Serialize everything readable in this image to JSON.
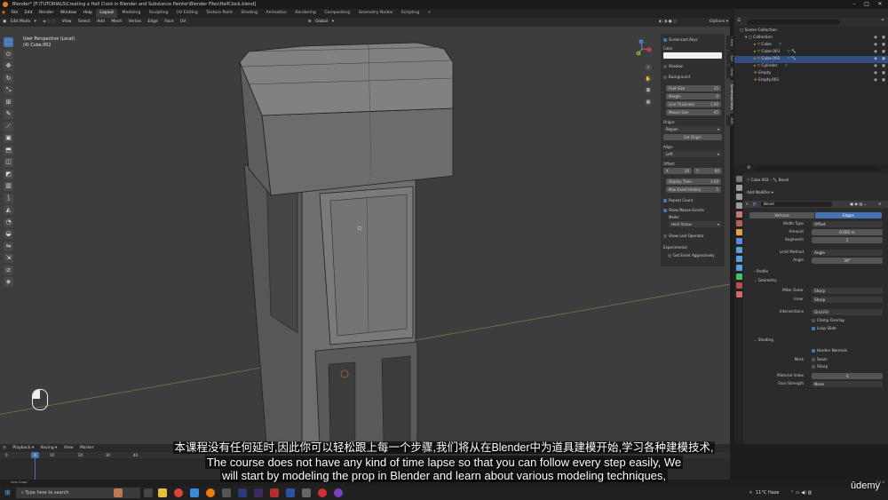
{
  "title_bar": {
    "title": "Blender* [F:\\TUTORIALS\\Creating a Hall Clock in Blender and Substance Painter\\Blender Files\\HallClock.blend]"
  },
  "menu": {
    "items": [
      "File",
      "Edit",
      "Render",
      "Window",
      "Help"
    ],
    "workspaces": [
      "Layout",
      "Modeling",
      "Sculpting",
      "UV Editing",
      "Texture Paint",
      "Shading",
      "Animation",
      "Rendering",
      "Compositing",
      "Geometry Nodes",
      "Scripting"
    ],
    "active_workspace": "Layout",
    "add_tab": "+",
    "scene": "Scene",
    "view_layer": "ViewLayer"
  },
  "viewport_header": {
    "mode": "Edit Mode",
    "menus": [
      "View",
      "Select",
      "Add",
      "Mesh",
      "Vertex",
      "Edge",
      "Face",
      "UV"
    ],
    "orientation": "Global",
    "options": "Options"
  },
  "viewport": {
    "view_name": "User Perspective (Local)",
    "object_name": "(4) Cube.002"
  },
  "axis_gizmo": {
    "x": "X",
    "y": "Y",
    "z": "Z"
  },
  "screencast_panel": {
    "header": "Screencast Keys",
    "color_label": "Color",
    "shadow_label": "Shadow",
    "background_label": "Background",
    "font_size": {
      "label": "Font Size",
      "value": "35"
    },
    "margin": {
      "label": "Margin",
      "value": "0"
    },
    "line_thickness": {
      "label": "Line Thickness",
      "value": "1.00"
    },
    "mouse_size": {
      "label": "Mouse Size",
      "value": "45"
    },
    "origin_label": "Origin:",
    "origin_value": "Region",
    "set_origin": "Set Origin",
    "align_label": "Align:",
    "align_value": "Left",
    "offset_label": "Offset:",
    "offset_x_label": "X",
    "offset_x": "20",
    "offset_y_label": "Y",
    "offset_y": "80",
    "display_time": {
      "label": "Display Time",
      "value": "3.00"
    },
    "max_event_history": {
      "label": "Max Event History",
      "value": "5"
    },
    "repeat_count": "Repeat Count",
    "show_mouse_events": "Show Mouse Events",
    "mode_label": "Mode:",
    "mode_value": "Hold Status",
    "show_last_operator": "Show Last Operator",
    "experimental_label": "Experimental",
    "get_event_aggressively": "Get Event Aggressively"
  },
  "side_tabs": [
    "Item",
    "Tool",
    "View",
    "Screencast Keys",
    "Edit"
  ],
  "outliner": {
    "root": "Scene Collection",
    "collection": "Collection",
    "objects": [
      {
        "name": "Cube",
        "selected": false
      },
      {
        "name": "Cube.001",
        "selected": false
      },
      {
        "name": "Cube.002",
        "selected": true
      },
      {
        "name": "Cylinder",
        "selected": false
      },
      {
        "name": "Empty",
        "selected": false
      },
      {
        "name": "Empty.001",
        "selected": false
      }
    ]
  },
  "properties": {
    "breadcrumb_object": "Cube.002",
    "breadcrumb_modifier": "Bevel",
    "add_modifier": "Add Modifier",
    "modifier_name": "Bevel",
    "affect_options": [
      "Vertices",
      "Edges"
    ],
    "affect_selected": "Edges",
    "width_type": {
      "label": "Width Type",
      "value": "Offset"
    },
    "amount": {
      "label": "Amount",
      "value": "0.001 m"
    },
    "segments": {
      "label": "Segments",
      "value": "1"
    },
    "limit_method": {
      "label": "Limit Method",
      "value": "Angle"
    },
    "angle": {
      "label": "Angle",
      "value": "30°"
    },
    "profile_section": "Profile",
    "geometry_section": "Geometry",
    "miter_outer": {
      "label": "Miter Outer",
      "value": "Sharp"
    },
    "inner": {
      "label": "Inner",
      "value": "Sharp"
    },
    "intersections": {
      "label": "Intersections",
      "value": "Grid Fill"
    },
    "clamp_overlap": "Clamp Overlap",
    "loop_slide": "Loop Slide",
    "shading_section": "Shading",
    "harden_normals": "Harden Normals",
    "mark_label": "Mark",
    "mark_seam": "Seam",
    "mark_sharp": "Sharp",
    "material_index": {
      "label": "Material Index",
      "value": "-1"
    },
    "face_strength": {
      "label": "Face Strength",
      "value": "None"
    }
  },
  "timeline": {
    "menus": [
      "Playback",
      "Keying",
      "View",
      "Marker"
    ],
    "current_frame": "4",
    "ticks": [
      "0",
      "10",
      "20",
      "30",
      "40"
    ]
  },
  "statusbar": {
    "left": "Axis Snap",
    "right": "3.4.0"
  },
  "subtitles": {
    "zh": "本课程没有任何延时,因此你可以轻松跟上每一个步骤,我们将从在Blender中为道具建模开始,学习各种建模技术,",
    "en_line1": "The course does not have any kind of time lapse so that you can follow every step easily, We",
    "en_line2": "will start by modeling the prop in Blender and learn about various modeling techniques,"
  },
  "taskbar": {
    "search_placeholder": "Type here to search",
    "weather": "11°C  Haze",
    "watermark": "ûdemy"
  },
  "colors": {
    "accent": "#4772b3",
    "selection": "#334d80",
    "blender_orange": "#e87d0d"
  }
}
